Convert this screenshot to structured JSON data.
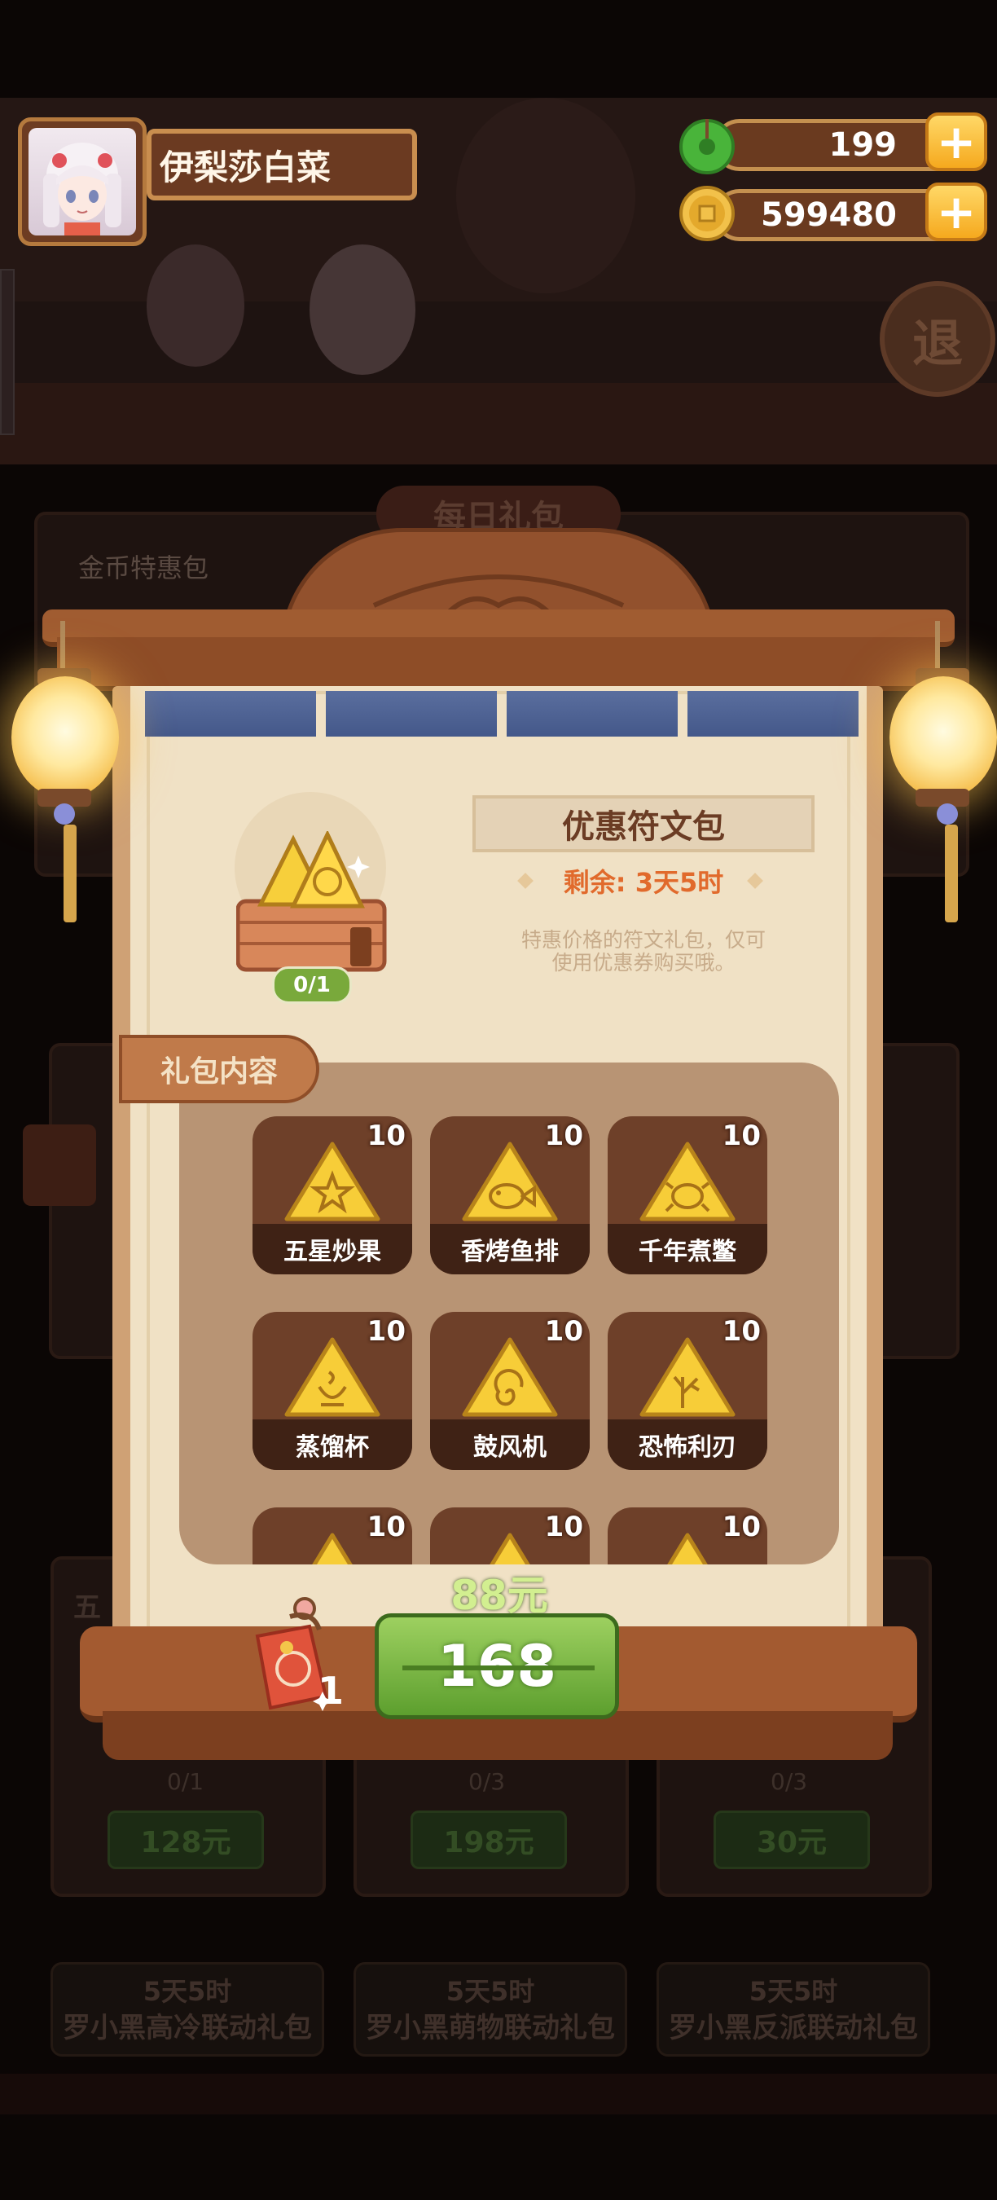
{
  "player": {
    "name": "伊梨莎白菜"
  },
  "resources": {
    "jade": {
      "value": "199",
      "icon": "jade-icon",
      "color": "#4bb83a"
    },
    "coins": {
      "value": "599480",
      "icon": "coin-icon",
      "color": "#e6b43a"
    }
  },
  "background": {
    "tab": "每日礼包",
    "section": "金币特惠包",
    "exit_label": "退",
    "side_card_label": "五",
    "counts": [
      "0/1",
      "0/3",
      "0/3"
    ],
    "prices": [
      "128元",
      "198元",
      "30元"
    ],
    "bundles": [
      {
        "time": "5天5时",
        "name": "罗小黑高冷联动礼包"
      },
      {
        "time": "5天5时",
        "name": "罗小黑萌物联动礼包"
      },
      {
        "time": "5天5时",
        "name": "罗小黑反派联动礼包"
      }
    ]
  },
  "popup": {
    "title": "优惠符文包",
    "remaining": "剩余: 3天5时",
    "description": "特惠价格的符文礼包，仅可使用优惠券购买哦。",
    "purchase_count": "0/1",
    "contents_label": "礼包内容",
    "items": [
      {
        "name": "五星炒果",
        "qty": "10",
        "symbol": "star"
      },
      {
        "name": "香烤鱼排",
        "qty": "10",
        "symbol": "fish"
      },
      {
        "name": "千年煮鳖",
        "qty": "10",
        "symbol": "turtle"
      },
      {
        "name": "蒸馏杯",
        "qty": "10",
        "symbol": "cup"
      },
      {
        "name": "鼓风机",
        "qty": "10",
        "symbol": "spiral"
      },
      {
        "name": "恐怖利刃",
        "qty": "10",
        "symbol": "blade"
      },
      {
        "name": "",
        "qty": "10",
        "symbol": ""
      },
      {
        "name": "",
        "qty": "10",
        "symbol": ""
      },
      {
        "name": "",
        "qty": "10",
        "symbol": ""
      }
    ],
    "coupon_count": "1",
    "sale_price": "88元",
    "original_price": "168",
    "accent_color": "#e16a2c"
  }
}
